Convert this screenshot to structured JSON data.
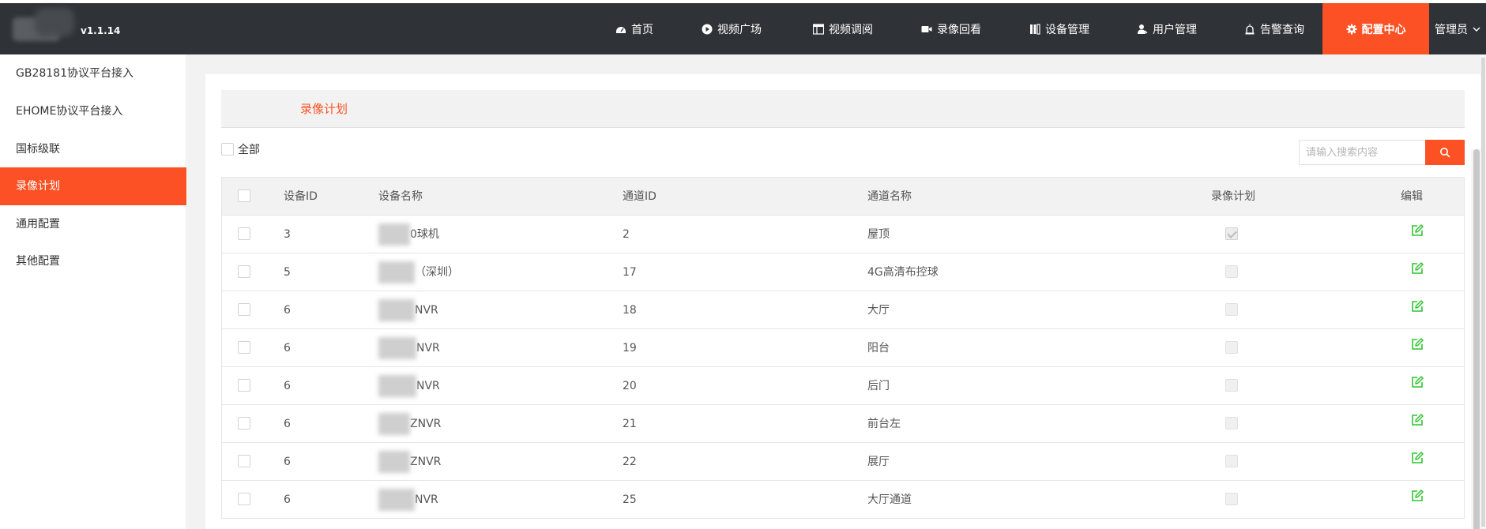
{
  "header": {
    "version": "v1.1.14",
    "nav": [
      {
        "label": "首页",
        "icon": "dashboard-icon"
      },
      {
        "label": "视频广场",
        "icon": "play-circle-icon"
      },
      {
        "label": "视频调阅",
        "icon": "layout-icon"
      },
      {
        "label": "录像回看",
        "icon": "video-camera-icon"
      },
      {
        "label": "设备管理",
        "icon": "device-icon"
      },
      {
        "label": "用户管理",
        "icon": "user-icon"
      },
      {
        "label": "告警查询",
        "icon": "alarm-icon"
      },
      {
        "label": "配置中心",
        "icon": "gear-icon",
        "active": true
      }
    ],
    "user_label": "管理员",
    "accent": "#fb5124",
    "bar_color": "#2f3337"
  },
  "sidebar": {
    "items": [
      {
        "label": "GB28181协议平台接入"
      },
      {
        "label": "EHOME协议平台接入"
      },
      {
        "label": "国标级联"
      },
      {
        "label": "录像计划",
        "active": true
      },
      {
        "label": "通用配置"
      },
      {
        "label": "其他配置"
      }
    ]
  },
  "main": {
    "tab": "录像计划",
    "select_all_label": "全部",
    "search_placeholder": "请输入搜索内容",
    "table": {
      "columns": [
        "设备ID",
        "设备名称",
        "通道ID",
        "通道名称",
        "录像计划",
        "编辑"
      ],
      "rows": [
        {
          "device_id": "3",
          "device_name": "0球机",
          "channel_id": "2",
          "channel_name": "屋顶",
          "plan": true
        },
        {
          "device_id": "5",
          "device_name": "（深圳）",
          "channel_id": "17",
          "channel_name": "4G高清布控球",
          "plan": false
        },
        {
          "device_id": "6",
          "device_name": "NVR",
          "channel_id": "18",
          "channel_name": "大厅",
          "plan": false
        },
        {
          "device_id": "6",
          "device_name": "NVR",
          "channel_id": "19",
          "channel_name": "阳台",
          "plan": false
        },
        {
          "device_id": "6",
          "device_name": "NVR",
          "channel_id": "20",
          "channel_name": "后门",
          "plan": false
        },
        {
          "device_id": "6",
          "device_name": "ZNVR",
          "channel_id": "21",
          "channel_name": "前台左",
          "plan": false
        },
        {
          "device_id": "6",
          "device_name": "ZNVR",
          "channel_id": "22",
          "channel_name": "展厅",
          "plan": false
        },
        {
          "device_id": "6",
          "device_name": "NVR",
          "channel_id": "25",
          "channel_name": "大厅通道",
          "plan": false
        }
      ]
    }
  }
}
